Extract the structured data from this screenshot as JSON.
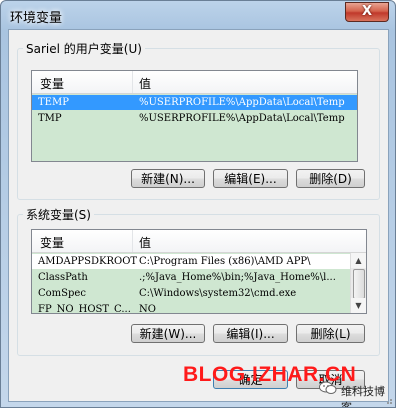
{
  "window": {
    "title": "环境变量",
    "close_glyph": "X"
  },
  "user_vars": {
    "group_label": "Sariel 的用户变量(U)",
    "col_variable": "变量",
    "col_value": "值",
    "rows": [
      {
        "name": "TEMP",
        "value": "%USERPROFILE%\\AppData\\Local\\Temp",
        "selected": true
      },
      {
        "name": "TMP",
        "value": "%USERPROFILE%\\AppData\\Local\\Temp",
        "selected": false
      }
    ],
    "new_label": "新建(N)...",
    "edit_label": "编辑(E)...",
    "delete_label": "删除(D)"
  },
  "system_vars": {
    "group_label": "系统变量(S)",
    "col_variable": "变量",
    "col_value": "值",
    "rows": [
      {
        "name": "AMDAPPSDKROOT",
        "value": "C:\\Program Files (x86)\\AMD APP\\"
      },
      {
        "name": "ClassPath",
        "value": ".;%Java_Home%\\bin;%Java_Home%\\l..."
      },
      {
        "name": "ComSpec",
        "value": "C:\\Windows\\system32\\cmd.exe"
      },
      {
        "name": "FP_NO_HOST_C...",
        "value": "NO"
      }
    ],
    "new_label": "新建(W)...",
    "edit_label": "编辑(I)...",
    "delete_label": "删除(L)"
  },
  "footer": {
    "ok_label": "确定",
    "cancel_label": "取消"
  },
  "watermark": {
    "text": "BLOG.IZHAR.CN",
    "account": "维科技博客",
    "color": "#ff1a1a"
  },
  "colors": {
    "selection": "#3399ff",
    "list_bg": "#cfe7d1"
  }
}
